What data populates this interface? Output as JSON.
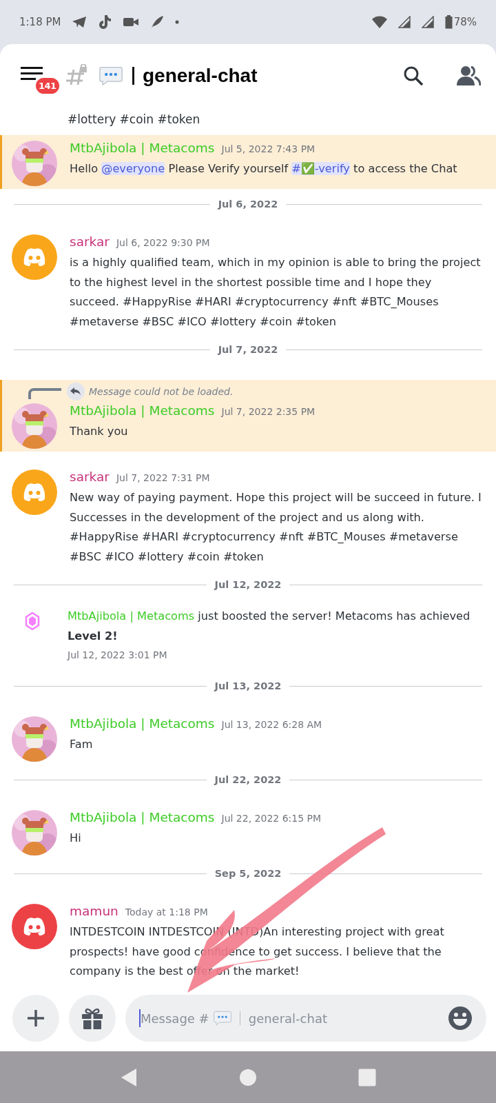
{
  "status_bar": {
    "time": "1:18 PM",
    "battery": "78%"
  },
  "header": {
    "badge": "141",
    "channel": "general-chat"
  },
  "feed": [
    {
      "kind": "continuation",
      "text": "#lottery #coin #token"
    },
    {
      "kind": "message",
      "highlighted": true,
      "author": "MtbAjibola | Metacoms",
      "color": "#3dcc26",
      "time": "Jul 5, 2022 7:43 PM",
      "body": [
        {
          "text": "Hello "
        },
        {
          "text": "@everyone",
          "kind": "mention"
        },
        {
          "text": " Please Verify yourself "
        },
        {
          "text": "#✅-verify",
          "kind": "mention"
        },
        {
          "text": "  to access the Chat"
        }
      ]
    },
    {
      "kind": "divider",
      "date": "Jul 6, 2022"
    },
    {
      "kind": "message",
      "highlighted": false,
      "avatar": {
        "kind": "logo",
        "color": "#faa61a"
      },
      "author": "sarkar",
      "color": "#c7317a",
      "time": "Jul 6, 2022 9:30 PM",
      "body": [
        {
          "text": "is a highly qualified team, which in my opinion is able to bring the project to the highest level in the shortest possible time and I hope they succeed. #HappyRise #HARI #cryptocurrency #nft #BTC_Mouses #metaverse #BSC #ICO #lottery #coin #token"
        }
      ]
    },
    {
      "kind": "divider",
      "date": "Jul 7, 2022"
    },
    {
      "kind": "message",
      "highlighted": true,
      "reply": "Message could not be loaded.",
      "author": "MtbAjibola | Metacoms",
      "color": "#3dcc26",
      "time": "Jul 7, 2022 2:35 PM",
      "body": [
        {
          "text": "Thank you"
        }
      ]
    },
    {
      "kind": "message",
      "highlighted": false,
      "avatar": {
        "kind": "logo",
        "color": "#faa61a"
      },
      "author": "sarkar",
      "color": "#c7317a",
      "time": "Jul 7, 2022 7:31 PM",
      "body": [
        {
          "text": "New way of paying payment. Hope this project will be succeed in future. I Successes in the development of the project and us along with. #HappyRise #HARI #cryptocurrency #nft #BTC_Mouses #metaverse #BSC #ICO #lottery #coin #token"
        }
      ]
    },
    {
      "kind": "divider",
      "date": "Jul 12, 2022"
    },
    {
      "kind": "boost",
      "author": "MtbAjibola | Metacoms",
      "color": "#3dcc26",
      "text": "just boosted the server! Metacoms has achieved **Level 2!**",
      "time": "Jul 12, 2022 3:01 PM"
    },
    {
      "kind": "divider",
      "date": "Jul 13, 2022"
    },
    {
      "kind": "message",
      "highlighted": false,
      "author": "MtbAjibola | Metacoms",
      "color": "#3dcc26",
      "time": "Jul 13, 2022 6:28 AM",
      "body": [
        {
          "text": "Fam"
        }
      ]
    },
    {
      "kind": "divider",
      "date": "Jul 22, 2022"
    },
    {
      "kind": "message",
      "highlighted": false,
      "author": "MtbAjibola | Metacoms",
      "color": "#3dcc26",
      "time": "Jul 22, 2022 6:15 PM",
      "body": [
        {
          "text": "Hi"
        }
      ]
    },
    {
      "kind": "divider",
      "date": "Sep 5, 2022"
    },
    {
      "kind": "message",
      "highlighted": false,
      "avatar": {
        "kind": "logo",
        "color": "#ed4245"
      },
      "author": "mamun",
      "color": "#c7317a",
      "time": "Today at 1:18 PM",
      "body": [
        {
          "text": "INTDESTCOIN INTDESTCOIN (INTD)An interesting project with great prospects! have good confidence to get success. I believe that the company is the best offer on the market!"
        }
      ]
    }
  ],
  "composer": {
    "placeholder": "Message #",
    "channel": "general-chat"
  }
}
